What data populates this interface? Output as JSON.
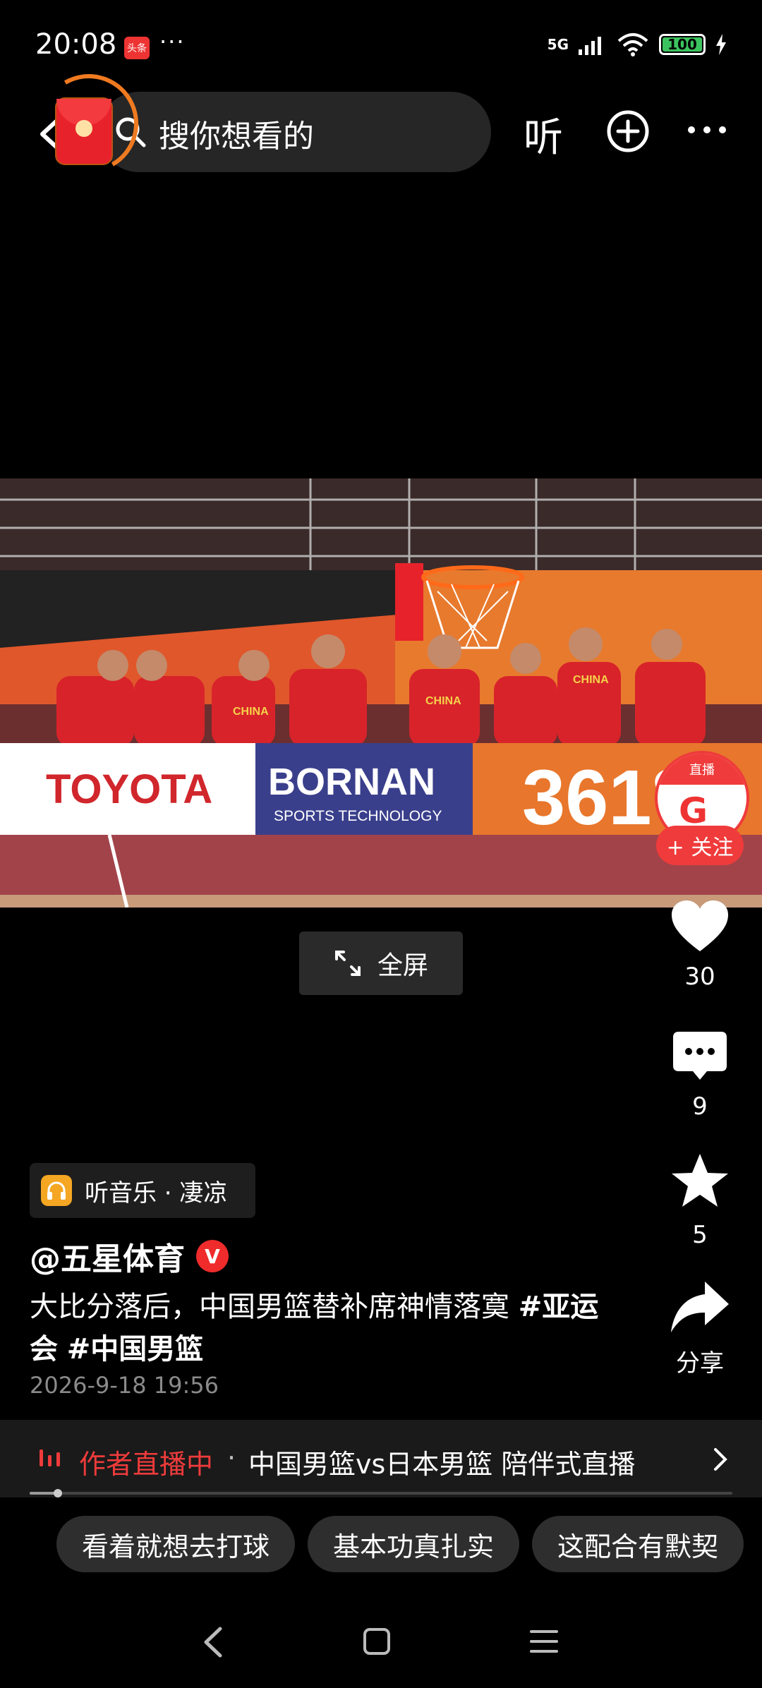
{
  "status_bar": {
    "time": "20:08",
    "app_badge": "头条",
    "dots": "···",
    "network": "5G",
    "battery": "100"
  },
  "top_bar": {
    "search_placeholder": "搜你想看的",
    "listen_label": "听"
  },
  "video": {
    "fullscreen_label": "全屏",
    "live_badge_label": "直播",
    "follow_label": "+ 关注",
    "ad_boards": [
      "TOYOTA",
      "BORNAN",
      "SPORTS TECHNOLOGY",
      "361°"
    ]
  },
  "actions": {
    "likes": "30",
    "comments": "9",
    "favorites": "5",
    "share_label": "分享"
  },
  "post": {
    "music": "听音乐 · 凄凉",
    "author": "@五星体育",
    "verified": "V",
    "caption_text": "大比分落后，中国男篮替补席神情落寞 ",
    "tag1": "#亚运会",
    "tag2": "#中国男篮",
    "time": "2026-9-18 19:56"
  },
  "live_banner": {
    "status": "作者直播中",
    "separator": "·",
    "title": "中国男篮vs日本男篮 陪伴式直播",
    "progress": 0.04
  },
  "suggestions": [
    "看着就想去打球",
    "基本功真扎实",
    "这配合有默契"
  ],
  "colors": {
    "accent_red": "#ef3b3b",
    "music_orange": "#f5a623",
    "battery_green": "#3cc35f"
  }
}
